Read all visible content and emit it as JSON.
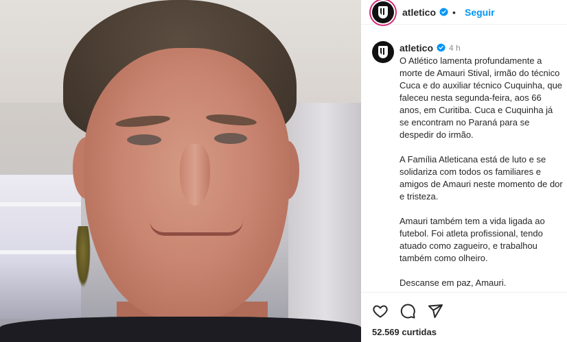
{
  "account": {
    "username": "atletico",
    "follow_label": "Seguir",
    "separator": "•"
  },
  "post": {
    "time_ago": "4 h",
    "caption": [
      "O Atlético lamenta profundamente a morte de Amauri Stival, irmão do técnico Cuca e do auxiliar técnico Cuquinha, que faleceu nesta segunda-feira, aos 66 anos, em Curitiba. Cuca e Cuquinha já se encontram no Paraná para se despedir do irmão.",
      "A Família Atleticana está de luto e se solidariza com todos os familiares e amigos de Amauri neste momento de dor e tristeza.",
      "Amauri também tem a vida ligada ao futebol. Foi atleta profissional, tendo atuado como zagueiro, e trabalhou também como olheiro.",
      "Descanse em paz, Amauri."
    ],
    "likes_text": "52.569 curtidas"
  },
  "icons": {
    "like": "heart-icon",
    "comment": "comment-icon",
    "share": "share-icon",
    "verified": "verified-badge-icon"
  },
  "colors": {
    "link_blue": "#0095f6",
    "verified_blue": "#0095f6",
    "story_ring": "#d62976",
    "text": "#262626",
    "muted": "#8e8e8e"
  }
}
